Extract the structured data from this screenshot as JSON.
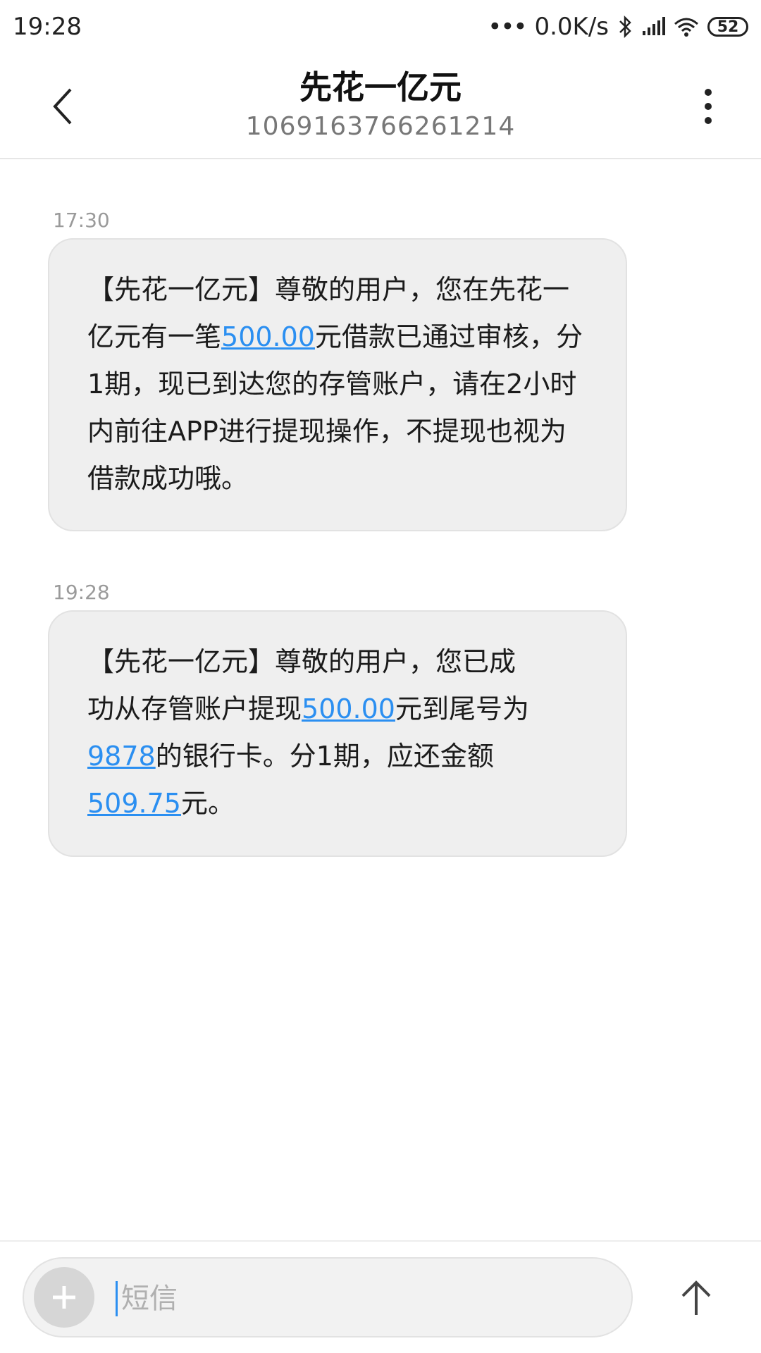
{
  "status_bar": {
    "time": "19:28",
    "network_speed": "0.0K/s",
    "battery_level": "52"
  },
  "header": {
    "contact_name": "先花一亿元",
    "contact_number": "1069163766261214"
  },
  "messages": [
    {
      "time": "17:30",
      "parts": [
        "【先花一亿元】尊敬的用户，您在先花一亿元有一笔",
        "500.00",
        "元借款已通过审核，分1期，现已到达您的存管账户，请在2小时内前往APP进行提现操作，不提现也视为借款成功哦。"
      ]
    },
    {
      "time": "19:28",
      "parts": [
        "【先花一亿元】尊敬的用户，您已成功从存管账户提现",
        "500.00",
        "元到尾号为",
        "9878",
        "的银行卡。分1期，应还金额",
        "509.75",
        "元。"
      ]
    }
  ],
  "composer": {
    "placeholder": "短信"
  },
  "colors": {
    "link": "#2b8ff1",
    "bubble": "#efefef"
  },
  "icons": {
    "back": "chevron-left-icon",
    "more": "more-vertical-icon",
    "add": "plus-icon",
    "send": "arrow-up-icon"
  }
}
